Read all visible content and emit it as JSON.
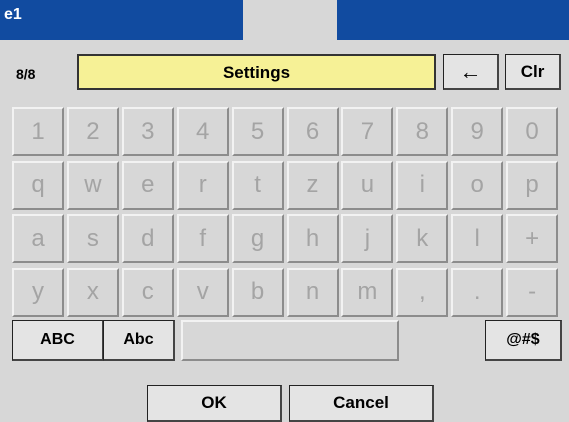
{
  "title_fragment": "e1",
  "counter": "8/8",
  "input_value": "Settings",
  "backspace": "←",
  "clear": "Clr",
  "keys": [
    [
      "1",
      "2",
      "3",
      "4",
      "5",
      "6",
      "7",
      "8",
      "9",
      "0"
    ],
    [
      "q",
      "w",
      "e",
      "r",
      "t",
      "z",
      "u",
      "i",
      "o",
      "p"
    ],
    [
      "a",
      "s",
      "d",
      "f",
      "g",
      "h",
      "j",
      "k",
      "l",
      "+"
    ],
    [
      "y",
      "x",
      "c",
      "v",
      "b",
      "n",
      "m",
      ",",
      ".",
      "-"
    ]
  ],
  "mode_abc": "ABC",
  "mode_abc_lower": "Abc",
  "mode_symbols": "@#$",
  "ok": "OK",
  "cancel": "Cancel"
}
